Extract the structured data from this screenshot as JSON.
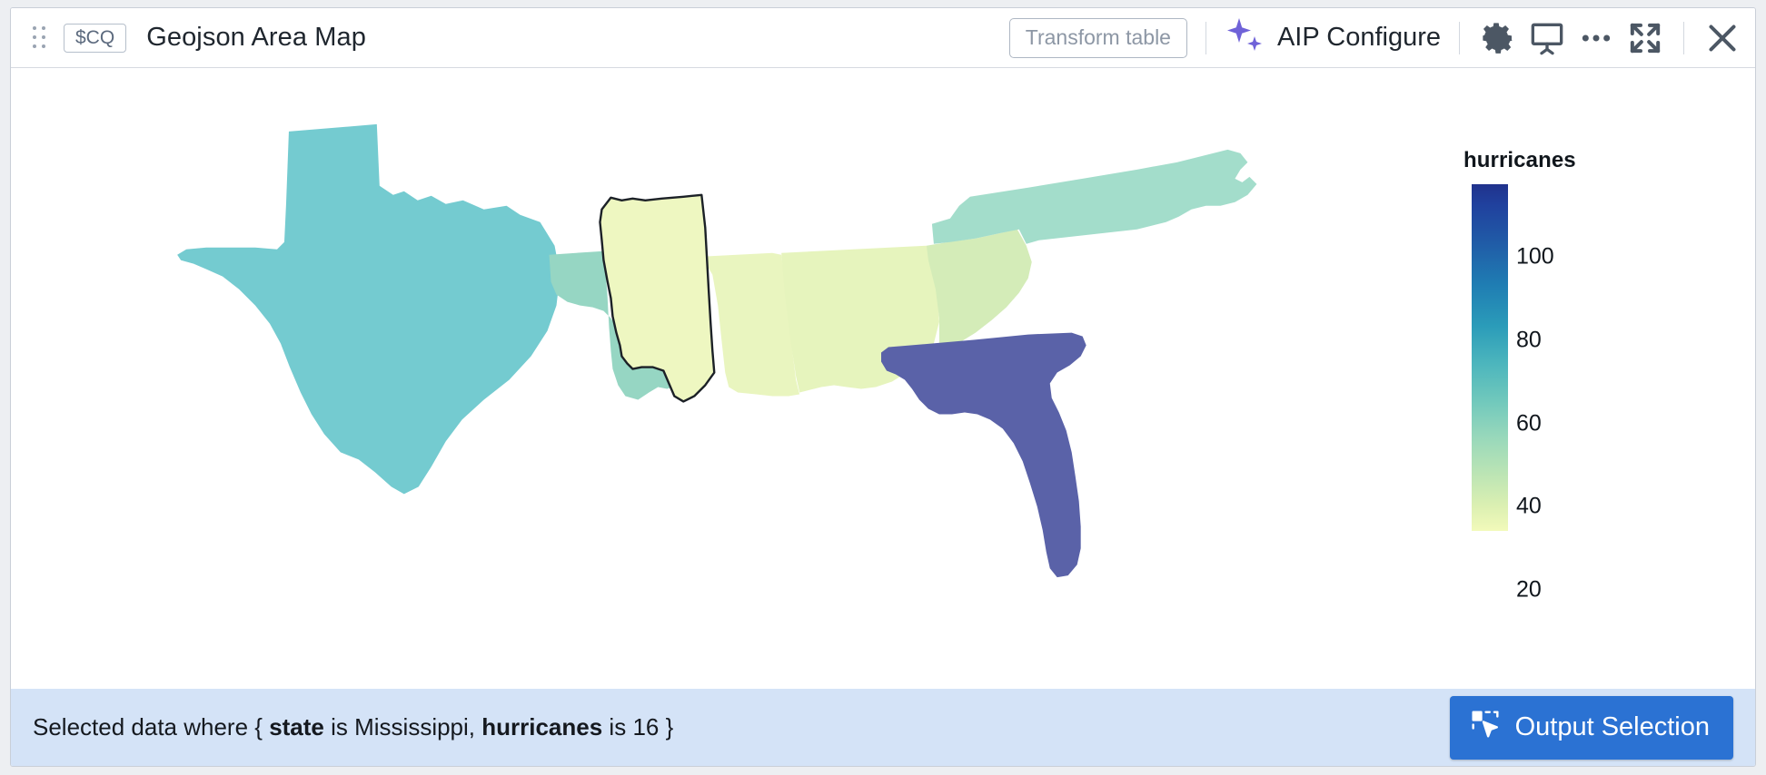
{
  "header": {
    "chip_label": "$CQ",
    "title": "Geojson Area Map",
    "transform_table_label": "Transform table",
    "aip_label": "AIP Configure"
  },
  "footer": {
    "prefix": "Selected data where { ",
    "field1": "state",
    "mid1": " is Mississippi, ",
    "field2": "hurricanes",
    "mid2": " is ",
    "value2": "16",
    "suffix": " }",
    "output_button_label": "Output Selection"
  },
  "colors": {
    "accent_blue": "#2b72d3",
    "aip_purple": "#6f62d8",
    "footer_band": "#d4e3f7",
    "selected_outline": "#1c2127"
  },
  "chart_data": {
    "type": "heatmap",
    "title": "Geojson Area Map",
    "legend_title": "hurricanes",
    "legend_position": "right",
    "colormap": "YlGnBu",
    "value_range": [
      16,
      118
    ],
    "tick_values": [
      100,
      80,
      60,
      40,
      20
    ],
    "selected_region": "Mississippi",
    "selected_value": 16,
    "regions": [
      {
        "name": "Texas",
        "value": 62,
        "color": "#74cbd0"
      },
      {
        "name": "Louisiana",
        "value": 47,
        "color": "#96d6c3"
      },
      {
        "name": "Mississippi",
        "value": 16,
        "color": "#eef7c1"
      },
      {
        "name": "Alabama",
        "value": 22,
        "color": "#e9f5bf"
      },
      {
        "name": "Georgia",
        "value": 24,
        "color": "#e6f4bd"
      },
      {
        "name": "Florida",
        "value": 117,
        "color": "#5a62a8"
      },
      {
        "name": "South Carolina",
        "value": 33,
        "color": "#d4ecb8"
      },
      {
        "name": "North Carolina",
        "value": 45,
        "color": "#a3ddcb"
      }
    ]
  }
}
